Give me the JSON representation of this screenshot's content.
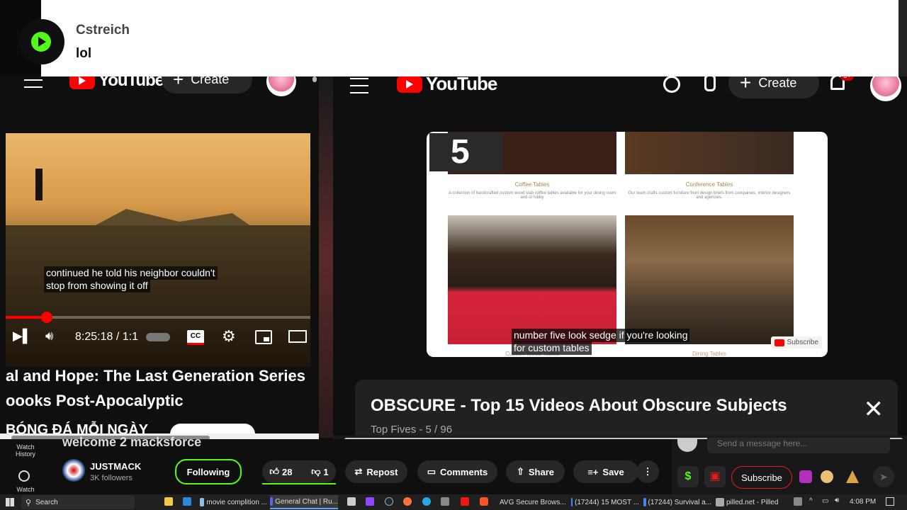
{
  "notification": {
    "username": "Cstreich",
    "message": "lol"
  },
  "left_player": {
    "create_label": "Create",
    "caption_line1": "continued he told his neighbor couldn't",
    "caption_line2": "stop from showing it off",
    "time": "8:25:18 / 1:1",
    "progress_fraction": 0.13,
    "title_line1": "al and Hope: The Last Generation Series",
    "title_line2": "oooks Post-Apocalyptic",
    "channel_partial": "BÓNG ĐÁ MỖI NGÀY"
  },
  "right_player": {
    "create_label": "Create",
    "notification_badge": "9+",
    "overlay_number": "5",
    "tiles": [
      {
        "label": "Coffee Tables",
        "desc": "A collection of handcrafted custom wood slab coffee tables available for your dining room and or lobby"
      },
      {
        "label": "Conference Tables",
        "desc": "Our team crafts custom furniture from design briefs from companies, interior designers and agencies."
      },
      {
        "label": "Custom Wood Tables",
        "desc": ""
      },
      {
        "label": "Dining Tables",
        "desc": ""
      }
    ],
    "caption_line1": "number five look sedge if you're looking",
    "caption_line2": "for custom tables",
    "mini_subscribe": "Subscribe",
    "playlist_title": "OBSCURE - Top 15 Videos About Obscure Subjects",
    "playlist_sub": "Top Fives - 5 / 96",
    "close_glyph": "✕"
  },
  "stream_bar": {
    "nav_watch_history": "Watch History",
    "nav_watch": "Watch",
    "partial_title": "welcome 2 macksforce",
    "channel_name": "JUSTMACK",
    "followers": "3K followers",
    "following_label": "Following",
    "likes": "28",
    "dislikes": "1",
    "repost": "Repost",
    "comments": "Comments",
    "share": "Share",
    "save": "Save",
    "chat_placeholder": "Send a message here...",
    "subscribe_label": "Subscribe"
  },
  "taskbar": {
    "search": "Search",
    "items": [
      {
        "label": "movie complition ...",
        "color": "#8fbfe0"
      },
      {
        "label": "General Chat | Ru...",
        "color": "#5865f2"
      },
      {
        "label": "AVG Secure Brows...",
        "color": "#f2b400"
      },
      {
        "label": "(17244) 15 MOST ...",
        "color": "#4285f4"
      },
      {
        "label": "(17244) Survival a...",
        "color": "#4285f4"
      },
      {
        "label": "pilled.net - Pilled",
        "color": "#aaaaaa"
      }
    ],
    "time": "4:08 PM"
  }
}
